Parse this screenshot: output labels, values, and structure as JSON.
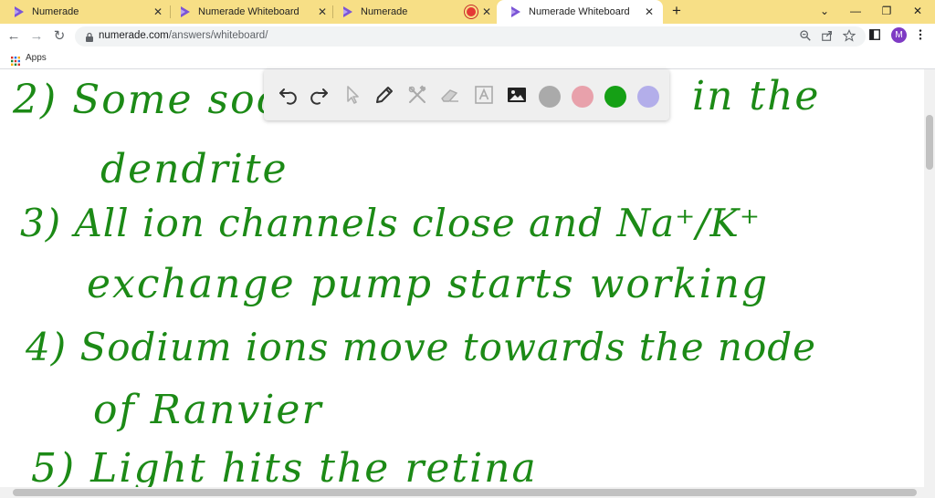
{
  "browser": {
    "tabs": [
      {
        "title": "Numerade",
        "active": false
      },
      {
        "title": "Numerade Whiteboard",
        "active": false
      },
      {
        "title": "Numerade",
        "active": false,
        "recording": true
      },
      {
        "title": "Numerade Whiteboard",
        "active": true
      }
    ],
    "new_tab_label": "+",
    "window_controls": {
      "dropdown": "⌄",
      "minimize": "—",
      "restore": "❐",
      "close": "✕"
    },
    "nav": {
      "back": "←",
      "forward": "→",
      "reload": "↻"
    },
    "address": {
      "host": "numerade.com",
      "path": "/answers/whiteboard/"
    },
    "profile_initial": "M",
    "bookmarks": {
      "apps_label": "Apps"
    }
  },
  "whiteboard": {
    "tools": [
      {
        "name": "undo-icon"
      },
      {
        "name": "redo-icon"
      },
      {
        "name": "select-icon"
      },
      {
        "name": "pen-icon"
      },
      {
        "name": "tools-icon"
      },
      {
        "name": "eraser-icon"
      },
      {
        "name": "text-icon"
      },
      {
        "name": "image-icon"
      }
    ],
    "colors": [
      "#aaaaaa",
      "#e8a1ab",
      "#15a015",
      "#b3aeea"
    ],
    "ink_color": "#1c8a16",
    "handwriting": [
      {
        "id": "l2",
        "text": "2)   Some  soc",
        "suffix": "in   the"
      },
      {
        "id": "l2b",
        "text": "dendrite"
      },
      {
        "id": "l3",
        "text": "3)   All  ion   channels   close   and   Na⁺/K⁺"
      },
      {
        "id": "l3b",
        "text": "exchange   pump   starts   working"
      },
      {
        "id": "l4",
        "text": "4)   Sodium   ions   move   towards   the   node"
      },
      {
        "id": "l4b",
        "text": "of   Ranvier"
      },
      {
        "id": "l5",
        "text": "5)   Light    hits   the   retina"
      }
    ]
  }
}
